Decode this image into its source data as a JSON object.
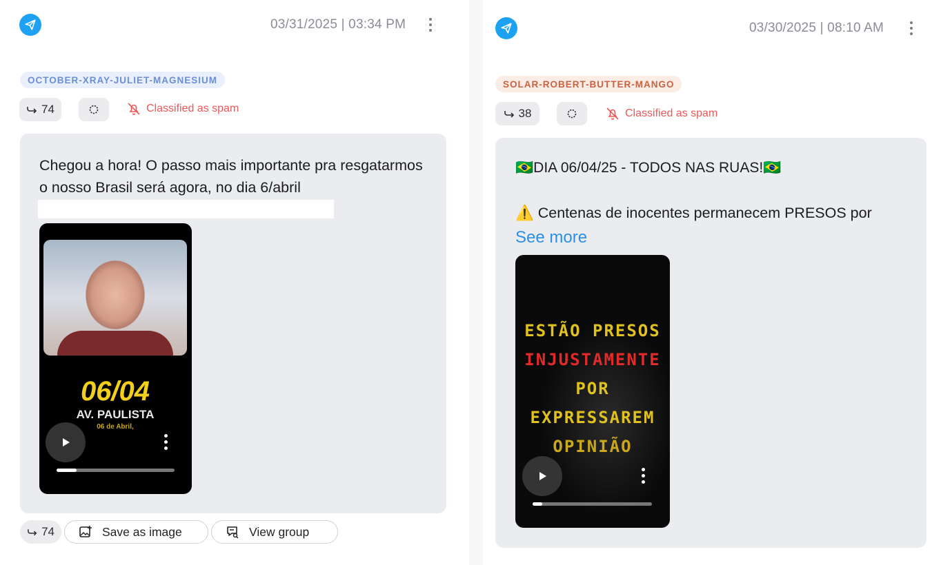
{
  "posts": [
    {
      "timestamp": "03/31/2025 | 03:34 PM",
      "tag": "OCTOBER-XRAY-JULIET-MAGNESIUM",
      "forwards": "74",
      "spam_label": "Classified as spam",
      "text": "Chegou a hora! O passo mais importante pra resgatarmos o nosso Brasil será agora, no dia 6/abril",
      "video": {
        "date_line": "06/04",
        "place_line": "AV. PAULISTA",
        "small_line": "06 de Abril,",
        "progress": 0.17
      },
      "footer": {
        "forwards": "74",
        "save_label": "Save as image",
        "group_label": "View group"
      }
    },
    {
      "timestamp": "03/30/2025 | 08:10 AM",
      "tag": "SOLAR-ROBERT-BUTTER-MANGO",
      "forwards": "38",
      "spam_label": "Classified as spam",
      "line1": "🇧🇷DIA 06/04/25 - TODOS NAS RUAS!🇧🇷",
      "line2": "⚠️ Centenas de inocentes permanecem PRESOS por",
      "see_more": "See more",
      "video": {
        "line1": "ESTÃO PRESOS",
        "line2": "INJUSTAMENTE",
        "line3": "POR",
        "line4": "EXPRESSAREM",
        "line5": "OPINIÃO",
        "progress": 0.08
      }
    }
  ],
  "icons": {
    "app": "telegram-icon",
    "forward": "forward-arrow-icon",
    "spinner": "loading-icon",
    "spam": "bell-off-icon",
    "save": "image-add-icon",
    "group": "chat-search-icon",
    "menu": "kebab-menu-icon",
    "play": "play-icon"
  },
  "colors": {
    "telegram": "#1da1f2",
    "spam": "#ee5757",
    "link": "#2b8fe6",
    "tag_blue_text": "#6a8fd6",
    "tag_red_text": "#c9623f",
    "message_bg": "#ebecf0"
  }
}
